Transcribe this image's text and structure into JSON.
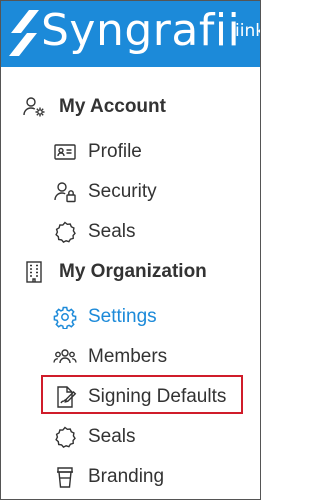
{
  "header": {
    "brand": "Syngrafii",
    "user_fragment": "iink",
    "logo_icon": "syngrafii-s-logo",
    "background_color": "#1c8ad9"
  },
  "nav": {
    "sections": [
      {
        "label": "My Account",
        "icon": "user-gear-icon",
        "items": [
          {
            "label": "Profile",
            "icon": "id-card-icon"
          },
          {
            "label": "Security",
            "icon": "user-lock-icon"
          },
          {
            "label": "Seals",
            "icon": "seal-icon"
          }
        ]
      },
      {
        "label": "My Organization",
        "icon": "building-icon",
        "items": [
          {
            "label": "Settings",
            "icon": "gear-icon",
            "active": true
          },
          {
            "label": "Members",
            "icon": "users-icon"
          },
          {
            "label": "Signing Defaults",
            "icon": "document-sign-icon",
            "highlighted": true
          },
          {
            "label": "Seals",
            "icon": "seal-icon"
          },
          {
            "label": "Branding",
            "icon": "cup-icon"
          }
        ]
      }
    ]
  },
  "colors": {
    "active": "#1c8ad9",
    "text": "#333333",
    "highlight_border": "#d01c2a"
  }
}
